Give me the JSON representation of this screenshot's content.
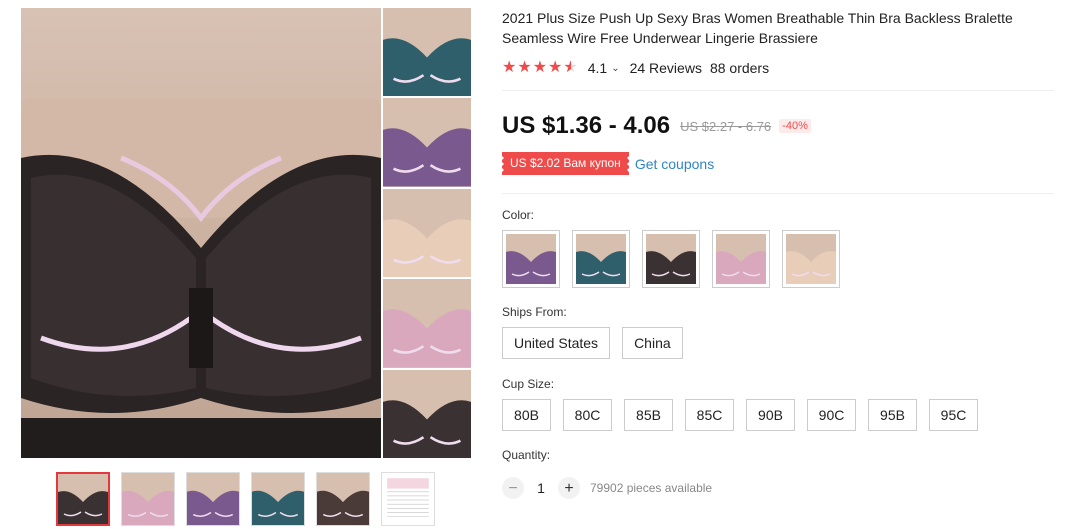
{
  "product": {
    "title": "2021 Plus Size Push Up Sexy Bras Women Breathable Thin Bra Backless Bralette Seamless Wire Free Underwear Lingerie Brassiere",
    "rating": "4.1",
    "rating_value": 4.1,
    "reviews": "24 Reviews",
    "orders": "88 orders"
  },
  "price": {
    "current": "US $1.36 - 4.06",
    "original": "US $2.27 - 6.76",
    "discount": "-40%"
  },
  "coupon": {
    "label": "US $2.02 Вам купон",
    "link": "Get coupons"
  },
  "labels": {
    "color": "Color:",
    "ships_from": "Ships From:",
    "cup_size": "Cup Size:",
    "quantity": "Quantity:"
  },
  "colors": [
    {
      "name": "purple",
      "color": "#7a5a8e"
    },
    {
      "name": "teal",
      "color": "#2f5f6a"
    },
    {
      "name": "black",
      "color": "#3a3232"
    },
    {
      "name": "pink",
      "color": "#d9a8bd"
    },
    {
      "name": "beige",
      "color": "#e8cdb8"
    }
  ],
  "ships_from": [
    "United States",
    "China"
  ],
  "cup_sizes": [
    "80B",
    "80C",
    "85B",
    "85C",
    "90B",
    "90C",
    "95B",
    "95C"
  ],
  "quantity": {
    "value": "1",
    "minus": "−",
    "plus": "+",
    "available": "79902 pieces available"
  },
  "gallery": {
    "side_thumb_colors": [
      "#2f5f6a",
      "#7a5a8e",
      "#e8cdb8",
      "#d9a8bd",
      "#3a3232"
    ],
    "bottom_thumb_colors": [
      "#3a3232",
      "#d9a8bd",
      "#7a5a8e",
      "#2f5f6a",
      "#4a3a38",
      "#f2f2f2"
    ]
  },
  "theme": {
    "accent": "#f04b4b",
    "link": "#2f86c4"
  }
}
